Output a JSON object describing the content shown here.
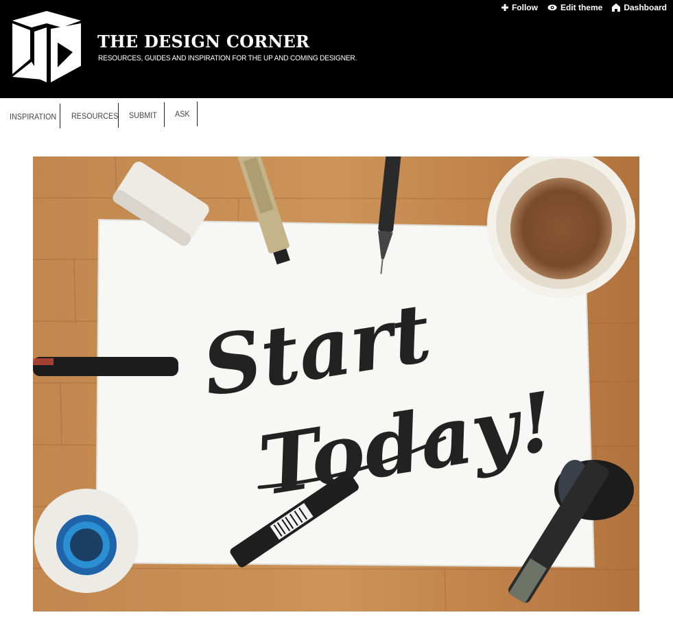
{
  "blog": {
    "title": "THE DESIGN CORNER",
    "description": "RESOURCES, GUIDES AND INSPIRATION FOR THE UP AND COMING DESIGNER."
  },
  "controls": {
    "follow_label": "Follow",
    "edit_theme_label": "Edit theme",
    "dashboard_label": "Dashboard"
  },
  "nav": {
    "items": [
      {
        "label": "INSPIRATION"
      },
      {
        "label": "RESOURCES"
      },
      {
        "label": "SUBMIT"
      },
      {
        "label": "ASK"
      }
    ]
  },
  "post": {
    "lettering_line1": "Start",
    "lettering_line2": "Today!"
  },
  "colors": {
    "header_bg": "#000000",
    "header_text": "#ffffff",
    "nav_text": "#444444",
    "wood": "#c8894a",
    "paper": "#f7f7f5",
    "coffee": "#7a4a2a"
  }
}
